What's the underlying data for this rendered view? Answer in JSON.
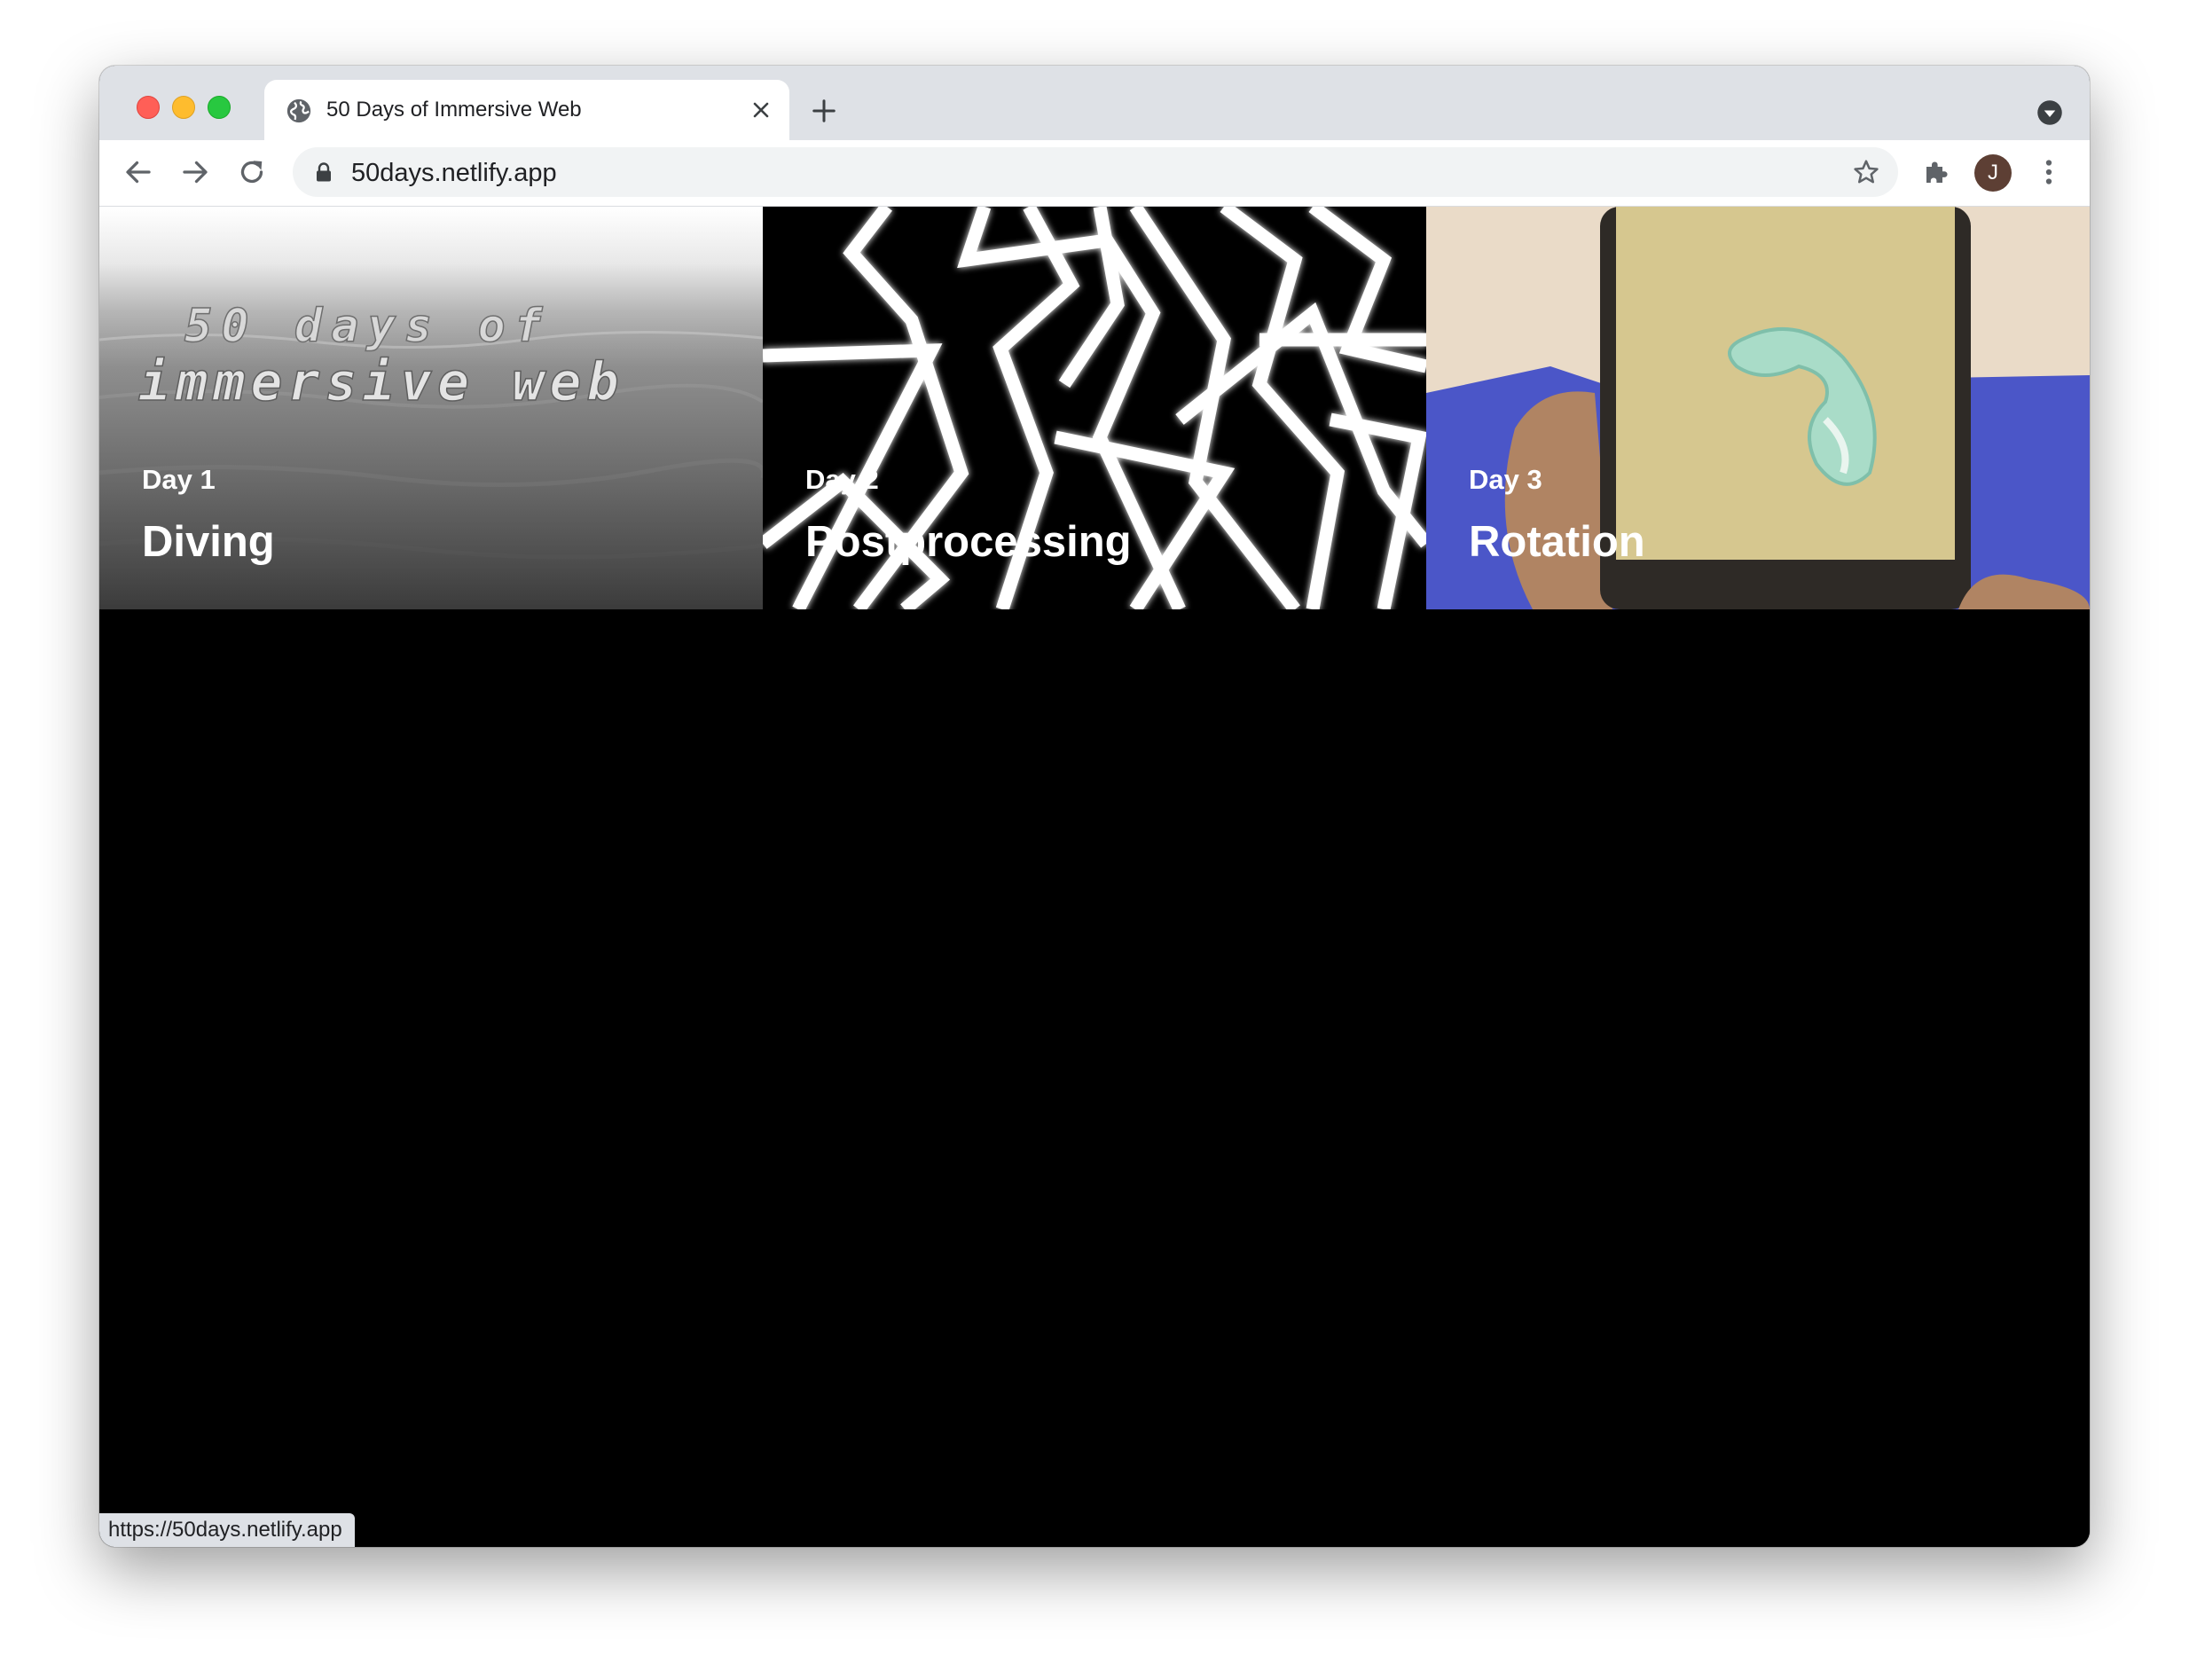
{
  "browser": {
    "tab": {
      "title": "50 Days of Immersive Web",
      "favicon": "globe-icon"
    },
    "address_bar": {
      "url": "50days.netlify.app",
      "secure_icon": "lock-icon"
    },
    "profile_initial": "J",
    "status_url": "https://50days.netlify.app"
  },
  "cards": [
    {
      "day": "Day 1",
      "title": "Diving",
      "art_text_line1": "50 days of",
      "art_text_line2": "immersive web"
    },
    {
      "day": "Day 2",
      "title": "Postprocessing"
    },
    {
      "day": "Day 3",
      "title": "Rotation"
    }
  ],
  "colors": {
    "tabstrip": "#dee1e6",
    "page_background": "#000000",
    "avatar": "#5d3f34",
    "card3_blue": "#4b56c8",
    "card3_screen": "#d6c78f"
  }
}
